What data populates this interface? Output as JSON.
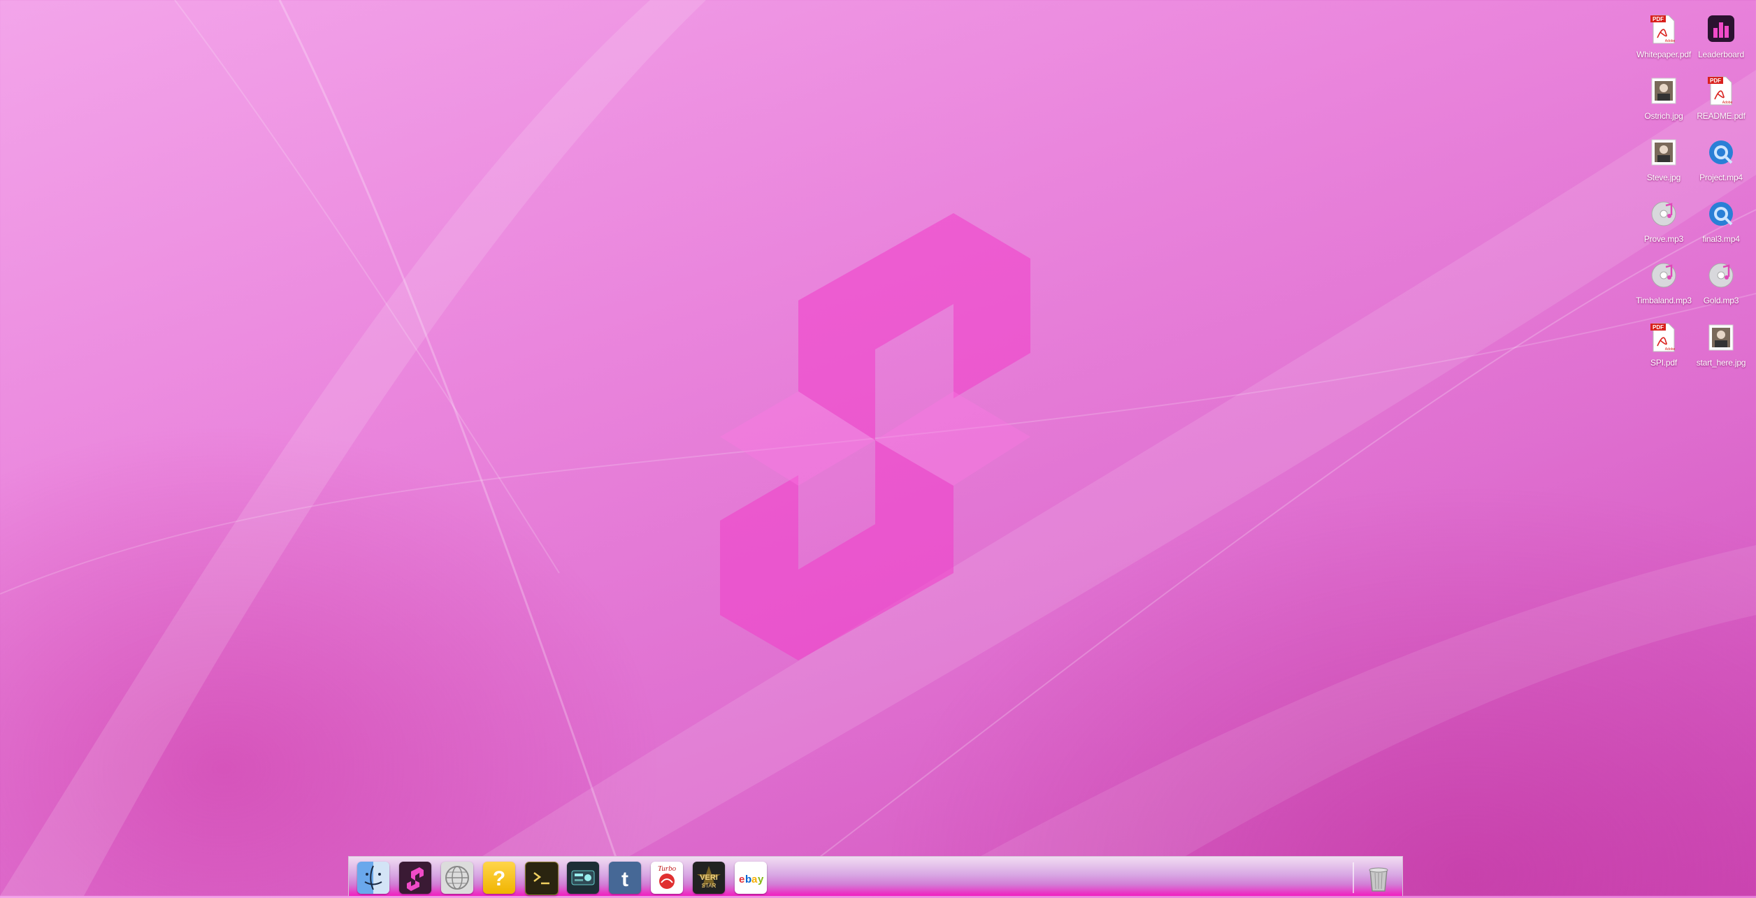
{
  "desktop": {
    "icons": [
      {
        "label": "Whitepaper.pdf",
        "icon": "pdf-icon"
      },
      {
        "label": "Leaderboard",
        "icon": "leaderboard-app-icon"
      },
      {
        "label": "Ostrich.jpg",
        "icon": "image-file-icon"
      },
      {
        "label": "README.pdf",
        "icon": "pdf-icon"
      },
      {
        "label": "Steve.jpg",
        "icon": "image-file-icon"
      },
      {
        "label": "Project.mp4",
        "icon": "quicktime-video-icon"
      },
      {
        "label": "Prove.mp3",
        "icon": "music-file-icon"
      },
      {
        "label": "final3.mp4",
        "icon": "quicktime-video-icon"
      },
      {
        "label": "Timbaland.mp3",
        "icon": "music-file-icon"
      },
      {
        "label": "Gold.mp3",
        "icon": "music-file-icon"
      },
      {
        "label": "SPI.pdf",
        "icon": "pdf-icon"
      },
      {
        "label": "start_here.jpg",
        "icon": "image-file-icon"
      }
    ],
    "pdf_badge": "PDF",
    "adobe_mark": "Adobe"
  },
  "dock": {
    "items": [
      {
        "name": "finder-icon"
      },
      {
        "name": "app-logo-icon"
      },
      {
        "name": "network-globe-icon"
      },
      {
        "name": "help-question-icon"
      },
      {
        "name": "terminal-icon"
      },
      {
        "name": "radio-icon"
      },
      {
        "name": "tumblr-icon"
      },
      {
        "name": "turbo-app-icon",
        "text": "Turbo"
      },
      {
        "name": "veristar-icon",
        "text": "VERI STAR"
      },
      {
        "name": "ebay-icon",
        "text": "ebY"
      }
    ],
    "trash": {
      "name": "trash-icon"
    }
  },
  "colors": {
    "wallpaper_light": "#f3a5ea",
    "wallpaper_dark": "#cf4cb8",
    "logo": "#f03cc8",
    "dock_bottom": "#f01fc0",
    "pdf_red": "#d9211d",
    "quicktime_blue": "#2a7fd6"
  }
}
